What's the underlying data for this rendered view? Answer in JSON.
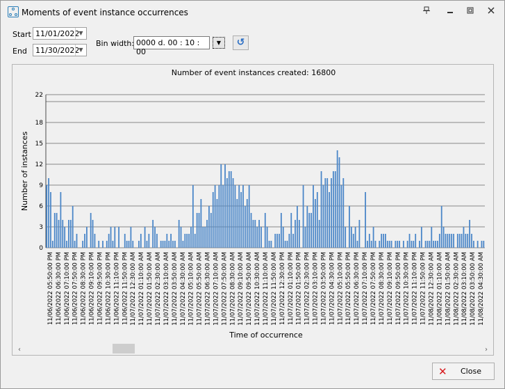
{
  "window": {
    "title": "Moments of event instance occurrences"
  },
  "controls": {
    "start_label": "Start",
    "start_value": "11/01/2022",
    "end_label": "End",
    "end_value": "11/30/2022",
    "bin_label": "Bin width:",
    "bin_value": "0000 d. 00 : 10 : 00"
  },
  "footer": {
    "close_label": "Close"
  },
  "icons": {
    "app": "app-icon",
    "pin": "pin-icon",
    "minimize": "minimize-icon",
    "restore": "restore-icon",
    "close": "close-icon",
    "refresh": "refresh-icon",
    "dropdown": "chevron-down-icon"
  },
  "colors": {
    "bar": "#4a86c8",
    "accent": "#2a6ec4",
    "close_x": "#d7191c"
  },
  "chart_data": {
    "type": "bar",
    "title": "Number of event instances created: 16800",
    "xlabel": "Time of occurrence",
    "ylabel": "Number of instances",
    "ylim": [
      0,
      22
    ],
    "yticks": [
      "0",
      "3",
      "6",
      "9",
      "12",
      "15",
      "18",
      "22"
    ],
    "xticks": [
      "11/06/2022 05:50:00 PM",
      "11/06/2022 06:30:00 PM",
      "11/06/2022 07:10:00 PM",
      "11/06/2022 07:50:00 PM",
      "11/06/2022 08:30:00 PM",
      "11/06/2022 09:10:00 PM",
      "11/06/2022 09:50:00 PM",
      "11/06/2022 10:30:00 PM",
      "11/06/2022 11:10:00 PM",
      "11/06/2022 11:50:00 PM",
      "11/07/2022 12:30:00 AM",
      "11/07/2022 01:10:00 AM",
      "11/07/2022 01:50:00 AM",
      "11/07/2022 02:30:00 AM",
      "11/07/2022 03:10:00 AM",
      "11/07/2022 03:50:00 AM",
      "11/07/2022 04:30:00 AM",
      "11/07/2022 05:10:00 AM",
      "11/07/2022 05:50:00 AM",
      "11/07/2022 06:30:00 AM",
      "11/07/2022 07:10:00 AM",
      "11/07/2022 07:50:00 AM",
      "11/07/2022 08:30:00 AM",
      "11/07/2022 09:10:00 AM",
      "11/07/2022 09:50:00 AM",
      "11/07/2022 10:30:00 AM",
      "11/07/2022 11:10:00 AM",
      "11/07/2022 11:50:00 AM",
      "11/07/2022 12:30:00 PM",
      "11/07/2022 01:10:00 PM",
      "11/07/2022 01:50:00 PM",
      "11/07/2022 02:30:00 PM",
      "11/07/2022 03:10:00 PM",
      "11/07/2022 03:50:00 PM",
      "11/07/2022 04:30:00 PM",
      "11/07/2022 05:10:00 PM",
      "11/07/2022 05:50:00 PM",
      "11/07/2022 06:30:00 PM",
      "11/07/2022 07:10:00 PM",
      "11/07/2022 07:50:00 PM",
      "11/07/2022 08:30:00 PM",
      "11/07/2022 09:10:00 PM",
      "11/07/2022 09:50:00 PM",
      "11/07/2022 10:30:00 PM",
      "11/07/2022 11:10:00 PM",
      "11/07/2022 11:50:00 PM",
      "11/08/2022 12:30:00 AM",
      "11/08/2022 01:10:00 AM",
      "11/08/2022 01:50:00 AM",
      "11/08/2022 02:30:00 AM",
      "11/08/2022 03:10:00 AM",
      "11/08/2022 03:50:00 AM",
      "11/08/2022 04:30:00 AM"
    ],
    "values": [
      9,
      10,
      8,
      1,
      5,
      5,
      4,
      8,
      4,
      3,
      1,
      4,
      4,
      6,
      1,
      2,
      0,
      0,
      1,
      2,
      3,
      0,
      5,
      4,
      2,
      0,
      1,
      0,
      1,
      0,
      1,
      2,
      3,
      1,
      3,
      0,
      3,
      0,
      0,
      2,
      1,
      1,
      3,
      1,
      0,
      0,
      1,
      2,
      0,
      3,
      1,
      2,
      0,
      4,
      3,
      2,
      0,
      1,
      1,
      1,
      2,
      1,
      2,
      1,
      1,
      0,
      4,
      3,
      1,
      2,
      2,
      2,
      3,
      9,
      2,
      5,
      5,
      7,
      3,
      3,
      4,
      6,
      5,
      8,
      9,
      7,
      9,
      12,
      9,
      12,
      10,
      11,
      11,
      10,
      9,
      7,
      9,
      8,
      9,
      6,
      7,
      9,
      5,
      4,
      4,
      3,
      4,
      3,
      0,
      5,
      3,
      1,
      1,
      0,
      2,
      2,
      2,
      5,
      3,
      1,
      1,
      2,
      5,
      2,
      4,
      6,
      4,
      0,
      9,
      3,
      6,
      5,
      5,
      9,
      7,
      8,
      4,
      11,
      9,
      10,
      10,
      8,
      10,
      11,
      11,
      14,
      13,
      9,
      10,
      3,
      0,
      6,
      3,
      2,
      3,
      1,
      4,
      0,
      0,
      8,
      1,
      2,
      1,
      3,
      1,
      0,
      1,
      2,
      2,
      2,
      1,
      1,
      1,
      0,
      1,
      1,
      1,
      0,
      1,
      0,
      1,
      2,
      1,
      1,
      2,
      0,
      1,
      3,
      0,
      1,
      1,
      1,
      3,
      1,
      1,
      1,
      2,
      6,
      3,
      2,
      2,
      2,
      2,
      2,
      0,
      2,
      2,
      2,
      3,
      2,
      2,
      4,
      2,
      1,
      0,
      1,
      0,
      1,
      1
    ]
  }
}
